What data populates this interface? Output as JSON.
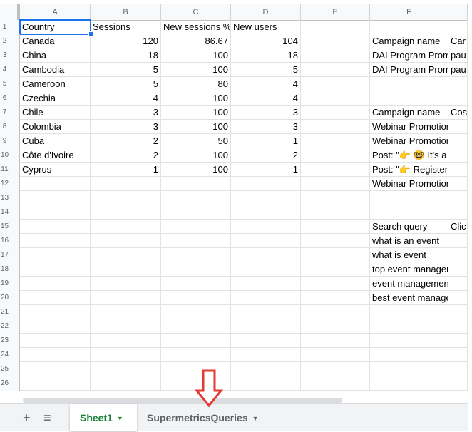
{
  "columns": [
    "A",
    "B",
    "C",
    "D",
    "E",
    "F"
  ],
  "rows": [
    {
      "num": "1",
      "a": "Country",
      "b": "Sessions",
      "c": "New sessions %",
      "d": "New users",
      "f": "",
      "g": ""
    },
    {
      "num": "2",
      "a": "Canada",
      "b": "120",
      "c": "86.67",
      "d": "104",
      "f": "Campaign name",
      "g": "Car"
    },
    {
      "num": "3",
      "a": "China",
      "b": "18",
      "c": "100",
      "d": "18",
      "f": "DAI Program Prom",
      "g": "pau"
    },
    {
      "num": "4",
      "a": "Cambodia",
      "b": "5",
      "c": "100",
      "d": "5",
      "f": "DAI Program Prom",
      "g": "pau"
    },
    {
      "num": "5",
      "a": "Cameroon",
      "b": "5",
      "c": "80",
      "d": "4",
      "f": "",
      "g": ""
    },
    {
      "num": "6",
      "a": "Czechia",
      "b": "4",
      "c": "100",
      "d": "4",
      "f": "",
      "g": ""
    },
    {
      "num": "7",
      "a": "Chile",
      "b": "3",
      "c": "100",
      "d": "3",
      "f": "Campaign name",
      "g": "Cos"
    },
    {
      "num": "8",
      "a": "Colombia",
      "b": "3",
      "c": "100",
      "d": "3",
      "f": "Webinar Promotion",
      "g": ""
    },
    {
      "num": "9",
      "a": "Cuba",
      "b": "2",
      "c": "50",
      "d": "1",
      "f": "Webinar Promotion",
      "g": ""
    },
    {
      "num": "10",
      "a": "Côte d'Ivoire",
      "b": "2",
      "c": "100",
      "d": "2",
      "f": "Post: \"👉 🤓 It's a",
      "g": ""
    },
    {
      "num": "11",
      "a": "Cyprus",
      "b": "1",
      "c": "100",
      "d": "1",
      "f": "Post: \"👉 Register",
      "g": ""
    },
    {
      "num": "12",
      "a": "",
      "b": "",
      "c": "",
      "d": "",
      "f": "Webinar Promotion",
      "g": ""
    },
    {
      "num": "13",
      "a": "",
      "b": "",
      "c": "",
      "d": "",
      "f": "",
      "g": ""
    },
    {
      "num": "14",
      "a": "",
      "b": "",
      "c": "",
      "d": "",
      "f": "",
      "g": ""
    },
    {
      "num": "15",
      "a": "",
      "b": "",
      "c": "",
      "d": "",
      "f": "Search query",
      "g": "Clic"
    },
    {
      "num": "16",
      "a": "",
      "b": "",
      "c": "",
      "d": "",
      "f": "what is an event",
      "g": ""
    },
    {
      "num": "17",
      "a": "",
      "b": "",
      "c": "",
      "d": "",
      "f": "what is event",
      "g": ""
    },
    {
      "num": "18",
      "a": "",
      "b": "",
      "c": "",
      "d": "",
      "f": "top event manager",
      "g": ""
    },
    {
      "num": "19",
      "a": "",
      "b": "",
      "c": "",
      "d": "",
      "f": "event management",
      "g": ""
    },
    {
      "num": "20",
      "a": "",
      "b": "",
      "c": "",
      "d": "",
      "f": "best event manage",
      "g": ""
    },
    {
      "num": "21",
      "a": "",
      "b": "",
      "c": "",
      "d": "",
      "f": "",
      "g": ""
    },
    {
      "num": "22",
      "a": "",
      "b": "",
      "c": "",
      "d": "",
      "f": "",
      "g": ""
    },
    {
      "num": "23",
      "a": "",
      "b": "",
      "c": "",
      "d": "",
      "f": "",
      "g": ""
    },
    {
      "num": "24",
      "a": "",
      "b": "",
      "c": "",
      "d": "",
      "f": "",
      "g": ""
    },
    {
      "num": "25",
      "a": "",
      "b": "",
      "c": "",
      "d": "",
      "f": "",
      "g": ""
    },
    {
      "num": "26",
      "a": "",
      "b": "",
      "c": "",
      "d": "",
      "f": "",
      "g": ""
    }
  ],
  "tabs": {
    "add_symbol": "+",
    "list_symbol": "≡",
    "sheet1": "Sheet1",
    "sheet2": "SupermetricsQueries",
    "caret": "▼"
  },
  "colors": {
    "accent": "#1a73e8",
    "active_tab": "#188038",
    "arrow": "#e53935"
  }
}
